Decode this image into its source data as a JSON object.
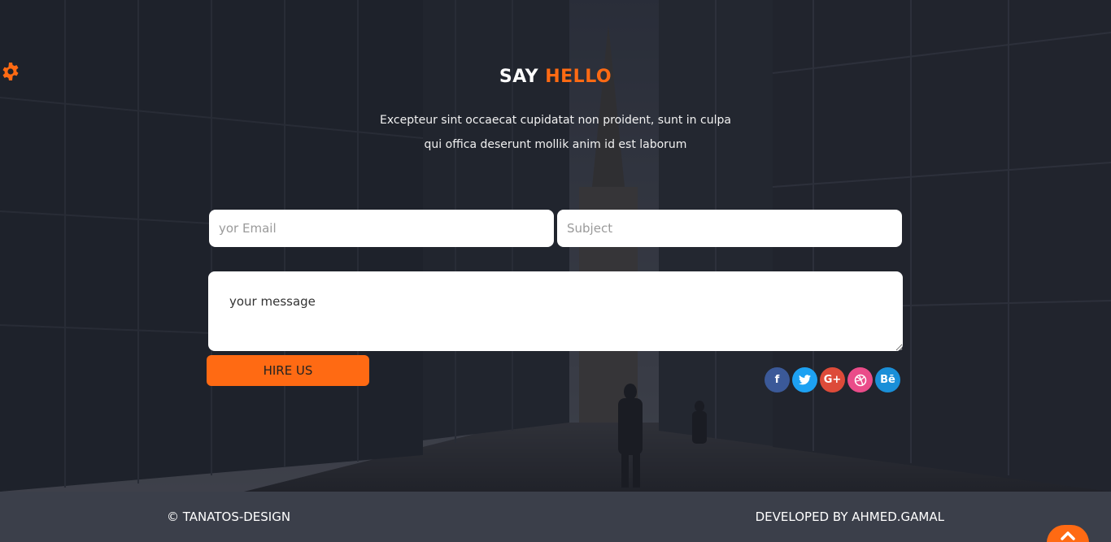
{
  "settings": {
    "icon": "gear-icon",
    "color": "#ff6a13"
  },
  "section": {
    "title_main": "SAY",
    "title_accent": "HELLO",
    "intro_line1": "Excepteur sint occaecat cupidatat non proident, sunt in culpa",
    "intro_line2": "qui offica deserunt mollik anim id est laborum"
  },
  "form": {
    "email_placeholder": "yor Email",
    "subject_placeholder": "Subject",
    "message_placeholder": "your message",
    "submit_label": "HIRE US"
  },
  "social": [
    {
      "icon": "facebook-icon",
      "glyph": "f",
      "color": "#3b5998"
    },
    {
      "icon": "twitter-icon",
      "glyph": "t",
      "color": "#1da1f2"
    },
    {
      "icon": "google-plus-icon",
      "glyph": "G+",
      "color": "#dd4b39"
    },
    {
      "icon": "dribbble-icon",
      "glyph": "◎",
      "color": "#ea4c89"
    },
    {
      "icon": "behance-icon",
      "glyph": "Bē",
      "color": "#1a8fd8"
    }
  ],
  "footer": {
    "copyright": "© TANATOS-DESIGN",
    "developer": "DEVELOPED BY AHMED.GAMAL"
  },
  "colors": {
    "accent": "#ff6a13",
    "footer_bg": "#3b3f4a"
  }
}
